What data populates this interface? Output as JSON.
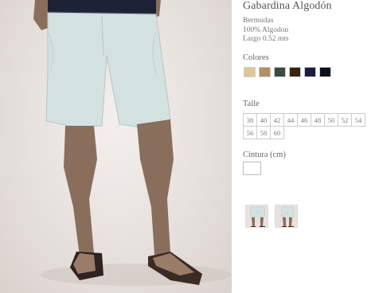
{
  "product": {
    "title": "Gabardina Algodón",
    "description": [
      "Bermudas",
      "100% Algodon",
      "Largo  0.52 mts"
    ]
  },
  "colors": {
    "label": "Colores",
    "swatches": [
      {
        "name": "beige",
        "hex": "#dcc894"
      },
      {
        "name": "tan",
        "hex": "#b09064"
      },
      {
        "name": "dark-green",
        "hex": "#3c4a3f"
      },
      {
        "name": "dark-brown",
        "hex": "#3b2214"
      },
      {
        "name": "navy",
        "hex": "#1c1d3e"
      },
      {
        "name": "black-navy",
        "hex": "#0c0f1e"
      }
    ]
  },
  "sizes": {
    "label": "Talle",
    "row1": [
      "38",
      "40",
      "42",
      "44",
      "46",
      "48",
      "50",
      "52",
      "54"
    ],
    "row2": [
      "56",
      "58",
      "60"
    ]
  },
  "waist": {
    "label": "Cintura (cm)",
    "value": ""
  },
  "thumbnails": [
    "front-view",
    "side-view"
  ],
  "photo": {
    "shorts_color": "#d4e1e1",
    "skin_color": "#8a6e5c",
    "shirt_color": "#1d2236",
    "sandal_color": "#3c2a24"
  }
}
